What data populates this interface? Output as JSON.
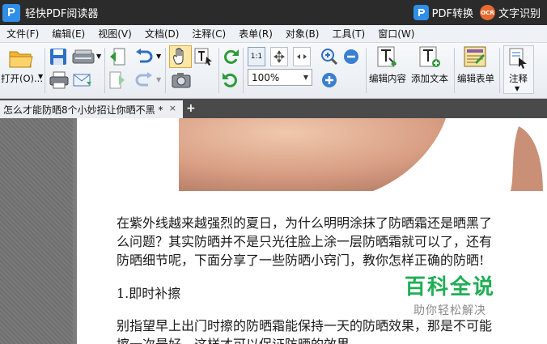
{
  "titlebar": {
    "logo_letter": "P",
    "app_title": "轻快PDF阅读器",
    "pdf_convert": "PDF转换",
    "ocr_badge": "OCR",
    "text_recognition": "文字识别"
  },
  "menu": [
    "文件(F)",
    "编辑(E)",
    "视图(V)",
    "文档(D)",
    "注释(C)",
    "表单(R)",
    "对象(B)",
    "工具(T)",
    "窗口(W)"
  ],
  "toolbar": {
    "open_label": "打开(O)...",
    "zoom_value": "100%",
    "fit_label": "1:1",
    "edit_content_label": "编辑内容",
    "add_text_label": "添加文本",
    "edit_form_label": "编辑表单",
    "annotate_label": "注释"
  },
  "tab": {
    "title": "怎么才能防晒8个小妙招让你晒不黑 *",
    "close": "×",
    "add": "+"
  },
  "document": {
    "line1": "在紫外线越来越强烈的夏日，为什么明明涂抹了防晒霜还是晒黑了",
    "line2": "么问题？其实防晒并不是只光往脸上涂一层防晒霜就可以了，还有",
    "line3": "防晒细节呢，下面分享了一些防晒小窍门，教你怎样正确的防晒!",
    "heading1": "1.即时补擦",
    "line4": "别指望早上出门时擦的防晒霜能保持一天的防晒效果，那是不可能",
    "line5": "擦一次最好，这样才可以保证防晒的效果。"
  },
  "watermark": {
    "title": "百科全说",
    "subtitle": "助你轻松解决"
  },
  "colors": {
    "titlebar_bg": "#2b2b2b",
    "brand_blue": "#2f8fe8",
    "watermark_green": "#1fae55",
    "toolbar_icon_green": "#2e9a3a"
  }
}
